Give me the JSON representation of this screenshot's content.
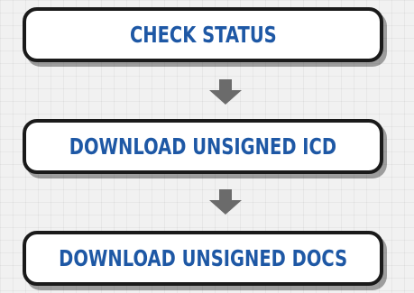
{
  "steps": [
    {
      "label": "CHECK STATUS"
    },
    {
      "label": "DOWNLOAD UNSIGNED ICD"
    },
    {
      "label": "DOWNLOAD UNSIGNED DOCS"
    }
  ],
  "colors": {
    "label_text": "#1e58a5",
    "box_border": "#1a1a1a",
    "arrow": "#6b6b6b"
  }
}
